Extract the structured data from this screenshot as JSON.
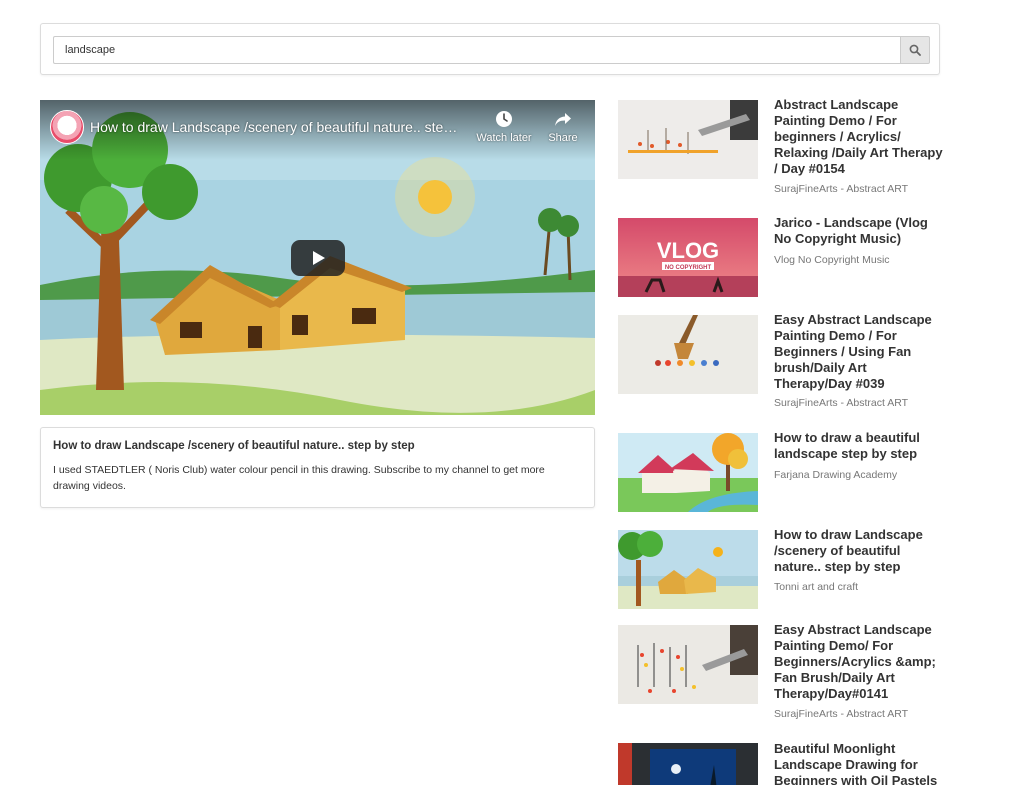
{
  "search": {
    "value": "landscape",
    "button_icon": "search-icon"
  },
  "player": {
    "title": "How to draw Landscape /scenery of beautiful nature.. step by step",
    "watch_later_label": "Watch later",
    "share_label": "Share",
    "play_icon": "play-icon"
  },
  "description": {
    "title": "How to draw Landscape /scenery of beautiful nature.. step by step",
    "text": "I used STAEDTLER ( Noris Club) water colour pencil in this drawing. Subscribe to my channel to get more drawing videos."
  },
  "related": [
    {
      "title": "Abstract Landscape Painting Demo / For beginners / Acrylics/ Relaxing /Daily Art Therapy / Day #0154",
      "channel": "SurajFineArts - Abstract ART"
    },
    {
      "title": "Jarico - Landscape (Vlog No Copyright Music)",
      "channel": "Vlog No Copyright Music",
      "thumb_text_1": "VLOG",
      "thumb_text_2": "NO COPYRIGHT"
    },
    {
      "title": "Easy Abstract Landscape Painting Demo / For Beginners / Using Fan brush/Daily Art Therapy/Day #039",
      "channel": "SurajFineArts - Abstract ART"
    },
    {
      "title": "How to draw a beautiful landscape step by step",
      "channel": "Farjana Drawing Academy"
    },
    {
      "title": "How to draw Landscape /scenery of beautiful nature.. step by step",
      "channel": "Tonni art and craft"
    },
    {
      "title": "Easy Abstract Landscape Painting Demo/ For Beginners/Acrylics &amp; Fan Brush/Daily Art Therapy/Day#0141",
      "channel": "SurajFineArts - Abstract ART"
    },
    {
      "title": "Beautiful Moonlight Landscape Drawing for Beginners with Oil Pastels",
      "channel": ""
    }
  ],
  "colors": {
    "accent_red": "#e8344e",
    "border": "#dcdcdc",
    "muted_text": "#777777"
  }
}
